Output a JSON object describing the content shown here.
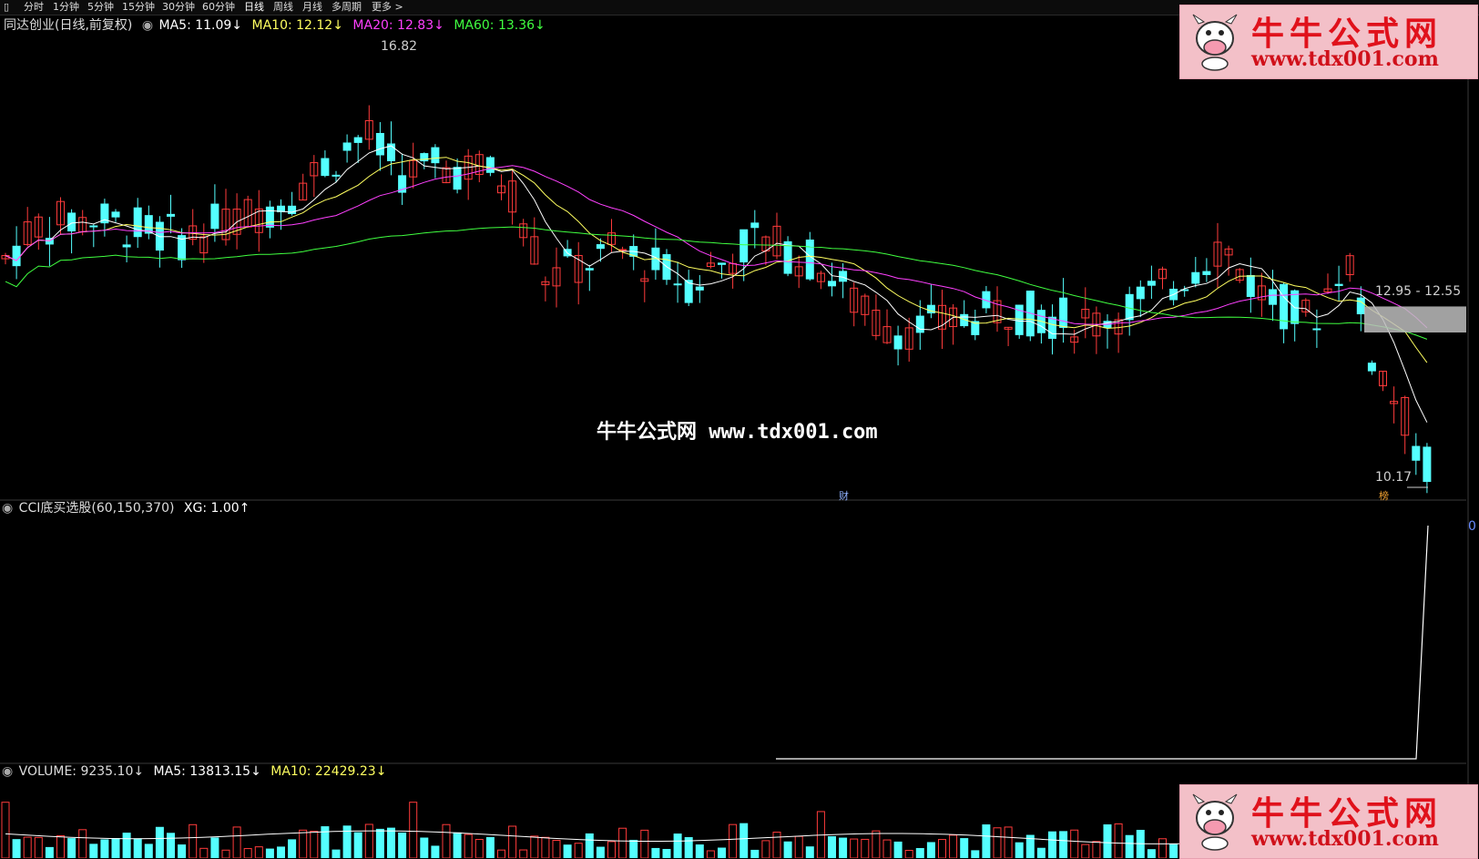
{
  "toolbar": {
    "tabs": [
      "分时",
      "1分钟",
      "5分钟",
      "15分钟",
      "30分钟",
      "60分钟",
      "日线",
      "周线",
      "月线",
      "多周期",
      "更多 >"
    ],
    "active": "日线"
  },
  "main_legend": {
    "title": "同达创业(日线,前复权)",
    "ma5": "MA5: 11.09↓",
    "ma10": "MA10: 12.12↓",
    "ma20": "MA20: 12.83↓",
    "ma60": "MA60: 13.36↓"
  },
  "price_labels": {
    "high": "16.82",
    "low": "10.17",
    "range": "12.95 - 12.55",
    "fin_tag": "财",
    "bang_tag": "榜"
  },
  "watermark": "牛牛公式网 www.tdx001.com",
  "cci_legend": {
    "title": "CCI底买选股(60,150,370)",
    "xg": "XG: 1.00↑",
    "right_label": "0"
  },
  "vol_legend": {
    "volume": "VOLUME: 9235.10↓",
    "ma5": "MA5: 13813.15↓",
    "ma10": "MA10: 22429.23↓"
  },
  "logo": {
    "brand": "牛牛公式网",
    "url": "www.tdx001.com"
  },
  "colors": {
    "up": "#ff3b3b",
    "down": "#54ffff",
    "ma5": "#ffffff",
    "ma10": "#ffff60",
    "ma20": "#ff40ff",
    "ma60": "#40ff40"
  },
  "chart_data": [
    {
      "type": "candlestick",
      "title": "同达创业(日线,前复权)",
      "annotated_high": 16.82,
      "annotated_low": 10.17,
      "band": [
        12.55,
        12.95
      ],
      "series": [
        {
          "name": "MA5",
          "last": 11.09
        },
        {
          "name": "MA10",
          "last": 12.12
        },
        {
          "name": "MA20",
          "last": 12.83
        },
        {
          "name": "MA60",
          "last": 13.36
        }
      ]
    },
    {
      "type": "line",
      "title": "CCI底买选股(60,150,370)",
      "series": [
        {
          "name": "XG",
          "last": 1.0
        }
      ]
    },
    {
      "type": "bar",
      "title": "VOLUME",
      "series": [
        {
          "name": "VOLUME",
          "last": 9235.1
        },
        {
          "name": "MA5",
          "last": 13813.15
        },
        {
          "name": "MA10",
          "last": 22429.23
        }
      ]
    }
  ]
}
